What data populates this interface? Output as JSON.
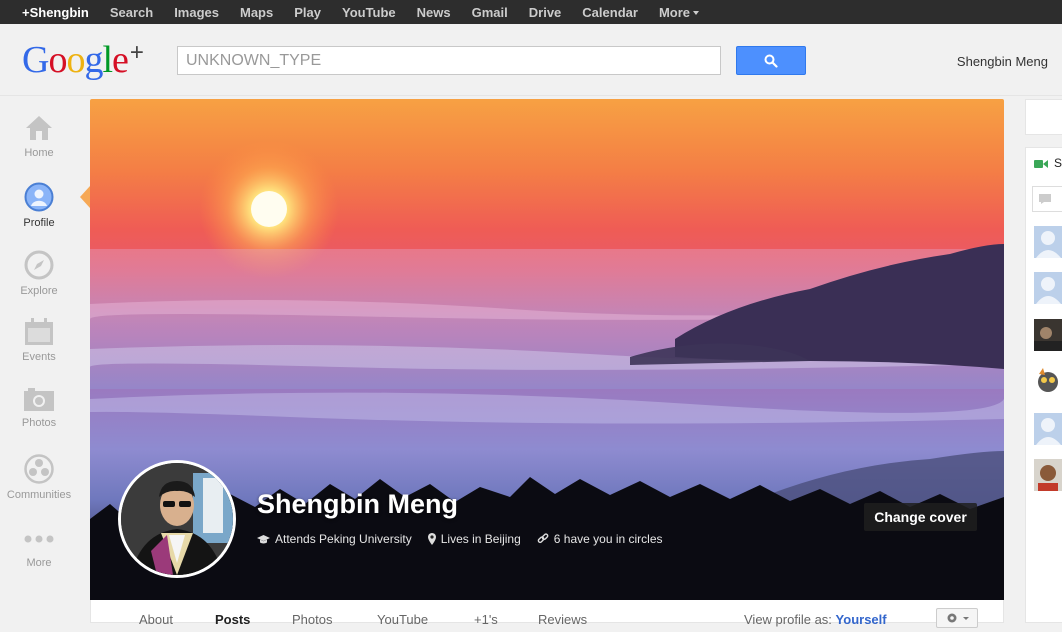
{
  "topbar": {
    "items": [
      "+Shengbin",
      "Search",
      "Images",
      "Maps",
      "Play",
      "YouTube",
      "News",
      "Gmail",
      "Drive",
      "Calendar",
      "More"
    ]
  },
  "header": {
    "logo": {
      "letters": [
        "G",
        "o",
        "o",
        "g",
        "l",
        "e"
      ],
      "plus": "+",
      "colors": [
        "#3369e8",
        "#d50f25",
        "#eeb211",
        "#3369e8",
        "#009925",
        "#d50f25"
      ]
    },
    "search_placeholder": "UNKNOWN_TYPE",
    "search_icon": "magnifier-icon",
    "username": "Shengbin Meng"
  },
  "leftnav": {
    "items": [
      {
        "label": "Home",
        "icon": "home-icon"
      },
      {
        "label": "Profile",
        "icon": "profile-icon",
        "active": true
      },
      {
        "label": "Explore",
        "icon": "compass-icon"
      },
      {
        "label": "Events",
        "icon": "calendar-icon"
      },
      {
        "label": "Photos",
        "icon": "camera-icon"
      },
      {
        "label": "Communities",
        "icon": "communities-icon"
      },
      {
        "label": "More",
        "icon": "more-dots-icon"
      }
    ]
  },
  "profile": {
    "name": "Shengbin Meng",
    "school": "Attends Peking University",
    "location": "Lives in Beijing",
    "circles": "6 have you in circles",
    "change_cover": "Change cover"
  },
  "tabs": {
    "items": [
      "About",
      "Posts",
      "Photos",
      "YouTube",
      "+1's",
      "Reviews"
    ],
    "active": "Posts",
    "view_as_label": "View profile as:",
    "view_as_value": "Yourself"
  },
  "chat": {
    "peek_label": "S"
  },
  "colors": {
    "accent_blue": "#4d90fe",
    "topbar_bg": "#2d2d2d"
  }
}
